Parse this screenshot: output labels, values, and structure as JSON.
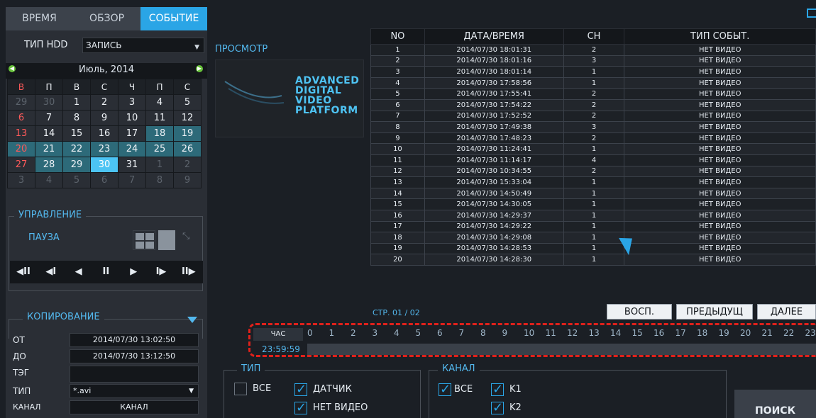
{
  "tabs": [
    "ВРЕМЯ",
    "ОБЗОР",
    "СОБЫТИЕ"
  ],
  "hdd": {
    "label": "ТИП HDD",
    "value": "ЗАПИСЬ"
  },
  "calendar": {
    "month": "Июль, 2014",
    "weekdays": [
      "В",
      "П",
      "В",
      "С",
      "Ч",
      "П",
      "С"
    ],
    "weeks": [
      [
        "29",
        "30",
        "1",
        "2",
        "3",
        "4",
        "5"
      ],
      [
        "6",
        "7",
        "8",
        "9",
        "10",
        "11",
        "12"
      ],
      [
        "13",
        "14",
        "15",
        "16",
        "17",
        "18",
        "19"
      ],
      [
        "20",
        "21",
        "22",
        "23",
        "24",
        "25",
        "26"
      ],
      [
        "27",
        "28",
        "29",
        "30",
        "31",
        "1",
        "2"
      ],
      [
        "3",
        "4",
        "5",
        "6",
        "7",
        "8",
        "9"
      ]
    ]
  },
  "control": {
    "title": "УПРАВЛЕНИЕ",
    "state": "ПАУЗА",
    "buttons": [
      "◀II",
      "◀I",
      "◀",
      "II",
      "▶",
      "I▶",
      "II▶"
    ]
  },
  "copy": {
    "title": "КОПИРОВАНИЕ",
    "from_label": "ОТ",
    "from_value": "2014/07/30 13:02:50",
    "to_label": "ДО",
    "to_value": "2014/07/30 13:12:50",
    "tag_label": "ТЭГ",
    "tag_value": "",
    "type_label": "ТИП",
    "type_value": "*.avi",
    "channel_label": "КАНАЛ",
    "channel_value": "КАНАЛ"
  },
  "preview": {
    "label": "ПРОСМОТР",
    "logo_lines": [
      "ADVANCED",
      "DIGITAL",
      "VIDEO",
      "PLATFORM"
    ]
  },
  "table": {
    "headers": [
      "NO",
      "ДАТА/ВРЕМЯ",
      "CH",
      "ТИП СОБЫТ."
    ],
    "rows": [
      [
        "1",
        "2014/07/30 18:01:31",
        "2",
        "НЕТ ВИДЕО"
      ],
      [
        "2",
        "2014/07/30 18:01:16",
        "3",
        "НЕТ ВИДЕО"
      ],
      [
        "3",
        "2014/07/30 18:01:14",
        "1",
        "НЕТ ВИДЕО"
      ],
      [
        "4",
        "2014/07/30 17:58:56",
        "1",
        "НЕТ ВИДЕО"
      ],
      [
        "5",
        "2014/07/30 17:55:41",
        "2",
        "НЕТ ВИДЕО"
      ],
      [
        "6",
        "2014/07/30 17:54:22",
        "2",
        "НЕТ ВИДЕО"
      ],
      [
        "7",
        "2014/07/30 17:52:52",
        "2",
        "НЕТ ВИДЕО"
      ],
      [
        "8",
        "2014/07/30 17:49:38",
        "3",
        "НЕТ ВИДЕО"
      ],
      [
        "9",
        "2014/07/30 17:48:23",
        "2",
        "НЕТ ВИДЕО"
      ],
      [
        "10",
        "2014/07/30 11:24:41",
        "1",
        "НЕТ ВИДЕО"
      ],
      [
        "11",
        "2014/07/30 11:14:17",
        "4",
        "НЕТ ВИДЕО"
      ],
      [
        "12",
        "2014/07/30 10:34:55",
        "2",
        "НЕТ ВИДЕО"
      ],
      [
        "13",
        "2014/07/30 15:33:04",
        "1",
        "НЕТ ВИДЕО"
      ],
      [
        "14",
        "2014/07/30 14:50:49",
        "1",
        "НЕТ ВИДЕО"
      ],
      [
        "15",
        "2014/07/30 14:30:05",
        "1",
        "НЕТ ВИДЕО"
      ],
      [
        "16",
        "2014/07/30 14:29:37",
        "1",
        "НЕТ ВИДЕО"
      ],
      [
        "17",
        "2014/07/30 14:29:22",
        "1",
        "НЕТ ВИДЕО"
      ],
      [
        "18",
        "2014/07/30 14:29:08",
        "1",
        "НЕТ ВИДЕО"
      ],
      [
        "19",
        "2014/07/30 14:28:53",
        "1",
        "НЕТ ВИДЕО"
      ],
      [
        "20",
        "2014/07/30 14:28:30",
        "1",
        "НЕТ ВИДЕО"
      ]
    ],
    "page_info": "СТР. 01 / 02"
  },
  "nav_buttons": {
    "play": "ВОСП.",
    "prev": "ПРЕДЫДУЩ",
    "next": "ДАЛЕЕ"
  },
  "timeline": {
    "hour_btn": "ЧАС",
    "hours": [
      "0",
      "1",
      "2",
      "3",
      "4",
      "5",
      "6",
      "7",
      "8",
      "9",
      "10",
      "11",
      "12",
      "13",
      "14",
      "15",
      "16",
      "17",
      "18",
      "19",
      "20",
      "21",
      "22",
      "23"
    ],
    "time": "23:59:59"
  },
  "filters": {
    "type_title": "ТИП",
    "all": "ВСЕ",
    "sensor": "ДАТЧИК",
    "no_video": "НЕТ ВИДЕО",
    "channel_title": "КАНАЛ",
    "ch_all": "ВСЕ",
    "k1": "K1",
    "k2": "K2"
  },
  "search_btn": "ПОИСК",
  "colors": {
    "accent": "#2aa5e6",
    "panel": "#2a2e35",
    "bg": "#1b1f25",
    "highlight": "#e0211b"
  }
}
